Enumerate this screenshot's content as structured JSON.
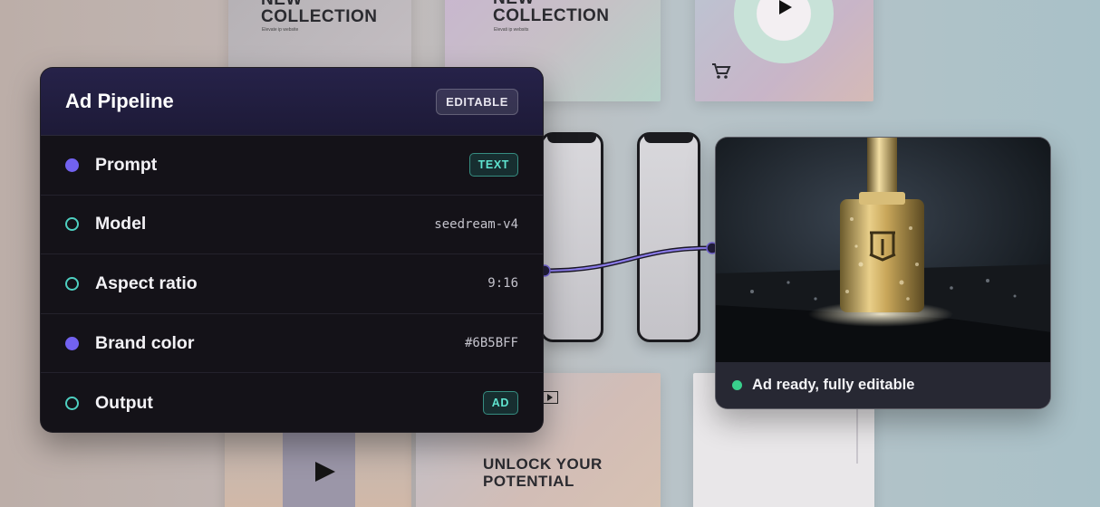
{
  "background": {
    "cards": [
      {
        "title": "NEW\nCOLLECTION",
        "subtitle": "Elevate ip website"
      },
      {
        "title": "NEW\nCOLLECTION",
        "subtitle": "Elevati ip websits"
      },
      {
        "title": "UNLOCK YOUR\nPOTENTIAL"
      }
    ],
    "icons": [
      "play-icon",
      "shopping-cart-icon"
    ]
  },
  "pipeline": {
    "title": "Ad Pipeline",
    "badge": "EDITABLE",
    "rows": [
      {
        "label": "Prompt",
        "dot": "filled",
        "tag": "TEXT"
      },
      {
        "label": "Model",
        "dot": "hollow",
        "value": "seedream-v4"
      },
      {
        "label": "Aspect ratio",
        "dot": "hollow",
        "value": "9:16"
      },
      {
        "label": "Brand color",
        "dot": "filled",
        "value": "#6B5BFF"
      },
      {
        "label": "Output",
        "dot": "hollow",
        "tag": "AD"
      }
    ]
  },
  "output": {
    "status": "Ad ready, fully editable",
    "status_color": "#39CF8C"
  },
  "colors": {
    "accent": "#6B5BFF",
    "teal": "#4ECFC0",
    "panel_bg": "#141218"
  }
}
